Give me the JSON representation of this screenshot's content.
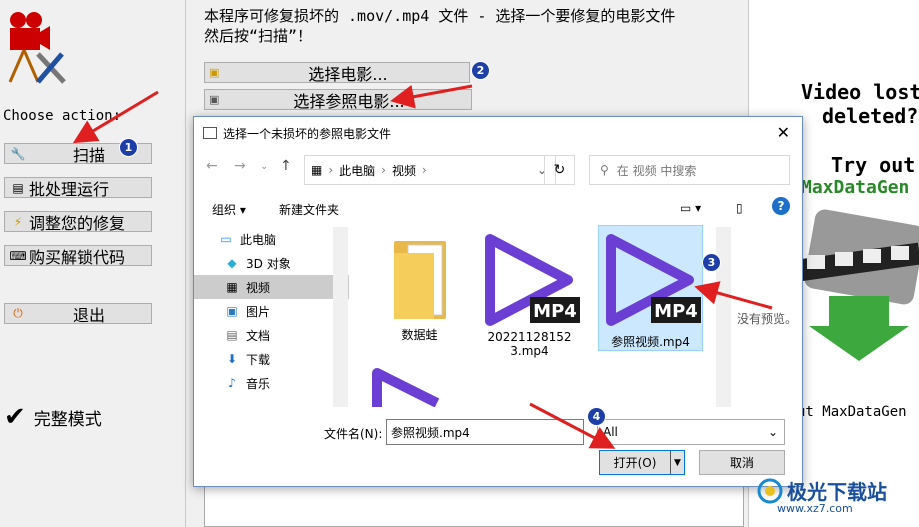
{
  "left": {
    "choose_label": "Choose action:",
    "buttons": [
      {
        "label": "扫描",
        "icon": "wrench-icon"
      },
      {
        "label": "批处理运行",
        "icon": "batch-icon"
      },
      {
        "label": "调整您的修复",
        "icon": "lightning-icon"
      },
      {
        "label": "购买解锁代码",
        "icon": "keyboard-icon"
      },
      {
        "label": "退出",
        "icon": "power-icon"
      }
    ],
    "full_mode_label": "完整模式"
  },
  "main": {
    "desc_line1": "本程序可修复损坏的 .mov/.mp4 文件 - 选择一个要修复的电影文件",
    "desc_line2": "然后按“扫描”！",
    "select_movie": "选择电影...",
    "select_ref": "选择参照电影..."
  },
  "ad": {
    "line1": "Video lost o",
    "line2": "deleted?",
    "line3": "Try out",
    "line4": "MaxDataGen",
    "footer": "ut MaxDataGen"
  },
  "dialog": {
    "title": "选择一个未损坏的参照电影文件",
    "breadcrumb": [
      "此电脑",
      "视频"
    ],
    "search_placeholder": "在 视频 中搜索",
    "toolbar": {
      "organize": "组织",
      "new_folder": "新建文件夹"
    },
    "tree": [
      "此电脑",
      "3D 对象",
      "视频",
      "图片",
      "文档",
      "下载",
      "音乐"
    ],
    "files": [
      {
        "name": "数据蛙",
        "type": "folder"
      },
      {
        "name": "202211281523.mp4",
        "type": "mp4"
      },
      {
        "name": "参照视频.mp4",
        "type": "mp4"
      }
    ],
    "no_preview": "没有预览。",
    "filename_label": "文件名(N):",
    "filename_value": "参照视频.mp4",
    "filetype_value": "All",
    "open_label": "打开(O)",
    "cancel_label": "取消"
  },
  "watermark": {
    "site": "极光下载站",
    "url": "www.xz7.com"
  },
  "badges": [
    "1",
    "2",
    "3",
    "4"
  ],
  "colors": {
    "arrow": "#e02020",
    "badge": "#1e3fa8",
    "mp4_purple": "#6b3fd4",
    "selection": "#cce8ff"
  }
}
